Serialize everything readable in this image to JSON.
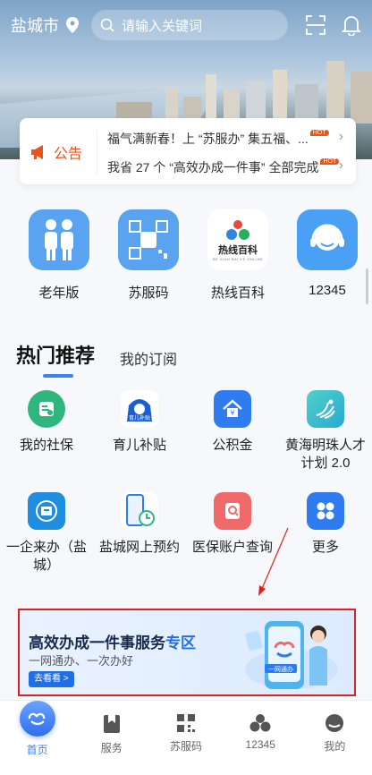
{
  "header": {
    "city": "盐城市",
    "search_placeholder": "请输入关键词"
  },
  "notice": {
    "label": "公告",
    "items": [
      {
        "text": "福气满新春！上 “苏服办” 集五福、...",
        "badge": "HOT"
      },
      {
        "text": "我省 27 个 “高效办成一件事” 全部完成",
        "badge": "HOT"
      }
    ]
  },
  "quick_apps": [
    {
      "label": "老年版",
      "icon": "elderly-couple-icon",
      "color": "#5aa3f0"
    },
    {
      "label": "苏服码",
      "icon": "su-qr-code-icon",
      "color": "#5aa3f0"
    },
    {
      "label": "热线百科",
      "icon": "hotline-encyclopedia-logo",
      "color": "#ffffff",
      "logo_text": "热线百科",
      "logo_subtext": "RE XIAN BAI KE ONLINE"
    },
    {
      "label": "12345",
      "icon": "headset-icon",
      "color": "#4aa0f5"
    }
  ],
  "tabs": {
    "active": "热门推荐",
    "other": "我的订阅"
  },
  "services": [
    {
      "label": "我的社保",
      "icon": "social-security-icon",
      "color": "#2eb67d"
    },
    {
      "label": "育儿补贴",
      "icon": "childcare-subsidy-icon",
      "color": "#ffffff",
      "icon_text": "育儿补贴"
    },
    {
      "label": "公积金",
      "icon": "housing-fund-icon",
      "color": "#2f7cf0"
    },
    {
      "label": "黄海明珠人才计划 2.0",
      "icon": "talent-plan-icon",
      "color": "#2ec4c9"
    },
    {
      "label": "一企来办（盐城）",
      "icon": "enterprise-service-icon",
      "color": "#1f8de0"
    },
    {
      "label": "盐城网上预约",
      "icon": "online-appointment-icon",
      "color": "#ffffff"
    },
    {
      "label": "医保账户查询",
      "icon": "medical-insurance-icon",
      "color": "#f06a6a"
    },
    {
      "label": "更多",
      "icon": "more-apps-icon",
      "color": "#2f7cf0"
    }
  ],
  "banner": {
    "title_main": "高效办成一件事服务",
    "title_highlight": "专区",
    "subtitle": "一网通办、一次办好",
    "button": "去看看 >",
    "badge": "一网通办"
  },
  "bottom_nav": [
    {
      "label": "首页",
      "icon": "home-icon",
      "active": true
    },
    {
      "label": "服务",
      "icon": "service-bookmark-icon",
      "active": false
    },
    {
      "label": "苏服码",
      "icon": "qr-code-icon",
      "active": false
    },
    {
      "label": "12345",
      "icon": "hotline-icon",
      "active": false
    },
    {
      "label": "我的",
      "icon": "profile-icon",
      "active": false
    }
  ],
  "colors": {
    "accent": "#3b82f6",
    "notice": "#e8541c",
    "annotation": "#e02020"
  }
}
